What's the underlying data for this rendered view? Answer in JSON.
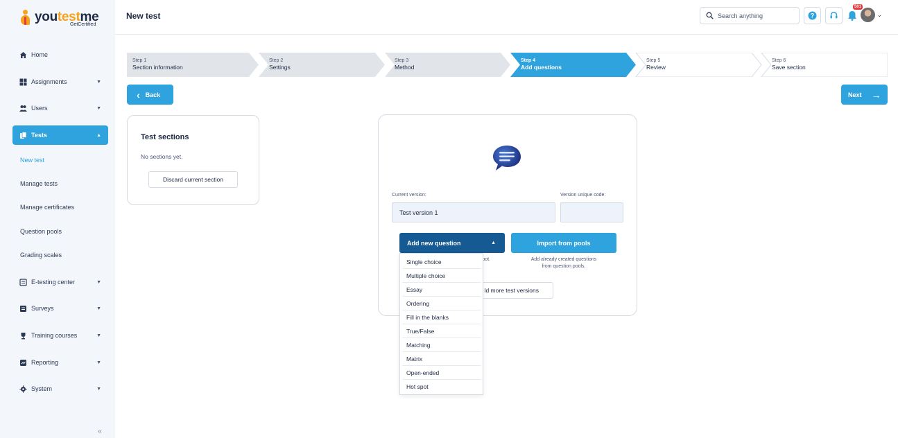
{
  "app": {
    "logo_prefix": "you",
    "logo_accent": "test",
    "logo_suffix": "me",
    "logo_sub": "GetCertified"
  },
  "sidebar": {
    "items": [
      {
        "label": "Home",
        "icon": "home-icon"
      },
      {
        "label": "Assignments",
        "icon": "assignments-icon"
      },
      {
        "label": "Users",
        "icon": "users-icon"
      },
      {
        "label": "Tests",
        "icon": "tests-icon"
      },
      {
        "label": "E-testing center",
        "icon": "e-testing-icon"
      },
      {
        "label": "Surveys",
        "icon": "surveys-icon"
      },
      {
        "label": "Training courses",
        "icon": "trophy-icon"
      },
      {
        "label": "Reporting",
        "icon": "reporting-icon"
      },
      {
        "label": "System",
        "icon": "gear-icon"
      }
    ],
    "sub_items": [
      "New test",
      "Manage tests",
      "Manage certificates",
      "Question pools",
      "Grading scales"
    ],
    "collapse_glyph": "«"
  },
  "header": {
    "title": "New test",
    "search_placeholder": "Search anything",
    "notification_count": "501"
  },
  "stepper": {
    "steps": [
      {
        "num": "Step 1",
        "title": "Section information"
      },
      {
        "num": "Step 2",
        "title": "Settings"
      },
      {
        "num": "Step 3",
        "title": "Method"
      },
      {
        "num": "Step 4",
        "title": "Add questions"
      },
      {
        "num": "Step 5",
        "title": "Review"
      },
      {
        "num": "Step 6",
        "title": "Save section"
      }
    ],
    "active_index": 3
  },
  "nav_buttons": {
    "back": "Back",
    "next": "Next"
  },
  "sections_panel": {
    "title": "Test sections",
    "empty_text": "No sections yet.",
    "discard_label": "Discard current section"
  },
  "main": {
    "current_version_label": "Current version:",
    "current_version_value": "Test version 1",
    "unique_code_label": "Version unique code:",
    "unique_code_value": "",
    "add_question_label": "Add new question",
    "import_label": "Import from pools",
    "add_hint_visible": "h spot.",
    "import_hint_line1": "Add already created questions",
    "import_hint_line2": "from question pools.",
    "versions_button_visible": "ld more test versions"
  },
  "dropdown": {
    "options": [
      "Single choice",
      "Multiple choice",
      "Essay",
      "Ordering",
      "Fill in the blanks",
      "True/False",
      "Matching",
      "Matrix",
      "Open-ended",
      "Hot spot"
    ]
  },
  "colors": {
    "accent": "#2fa3dd",
    "dark_accent": "#165a94",
    "step_active": "#2fa3dd",
    "step_inactive": "#e1e5ea",
    "badge": "#e23c3c"
  }
}
